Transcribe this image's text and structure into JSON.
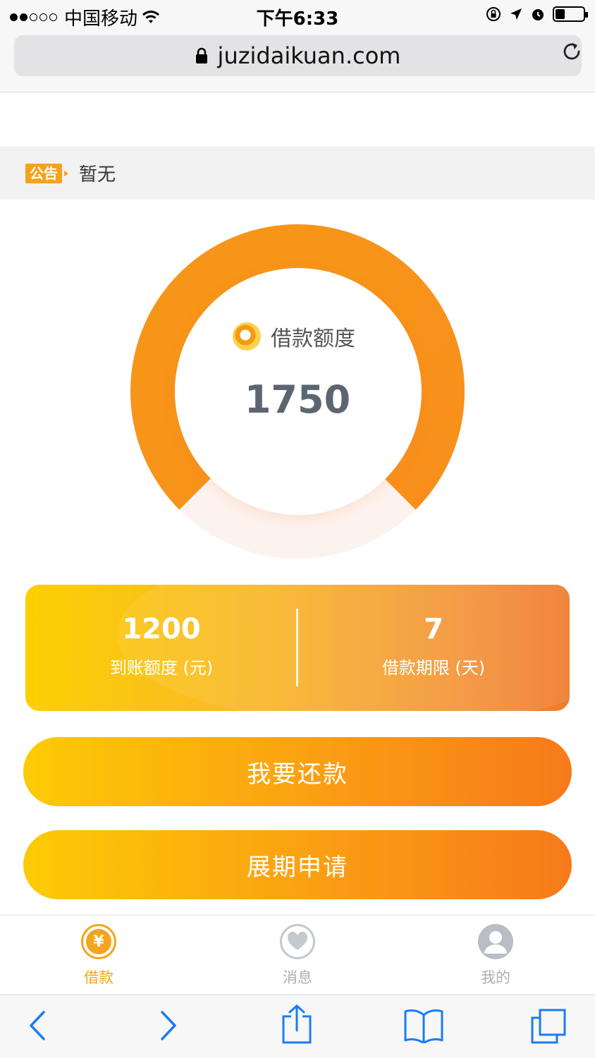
{
  "status_bar": {
    "carrier": "中国移动",
    "time": "下午6:33",
    "signal_dots_filled": 2,
    "signal_dots_total": 5,
    "battery_level": 0.35
  },
  "browser": {
    "url": "juzidaikuan.com",
    "lock_icon": "lock-icon",
    "reload_icon": "reload-icon"
  },
  "notice": {
    "tag": "公告",
    "text": "暂无"
  },
  "credit": {
    "label": "借款额度",
    "value": "1750",
    "gauge_fill_fraction": 0.75,
    "color": "#f7931a"
  },
  "card": {
    "left": {
      "value": "1200",
      "label": "到账额度 (元)"
    },
    "right": {
      "value": "7",
      "label": "借款期限 (天)"
    }
  },
  "buttons": {
    "repay": "我要还款",
    "extend": "展期申请"
  },
  "tabbar": {
    "items": [
      {
        "label": "借款",
        "icon": "yuan-icon",
        "active": true
      },
      {
        "label": "消息",
        "icon": "heart-icon",
        "active": false
      },
      {
        "label": "我的",
        "icon": "user-icon",
        "active": false
      }
    ]
  },
  "colors": {
    "accent": "#f7931a",
    "gradient_start": "#fccb06",
    "gradient_end": "#f77a1b",
    "ios_blue": "#1b7cf2"
  }
}
